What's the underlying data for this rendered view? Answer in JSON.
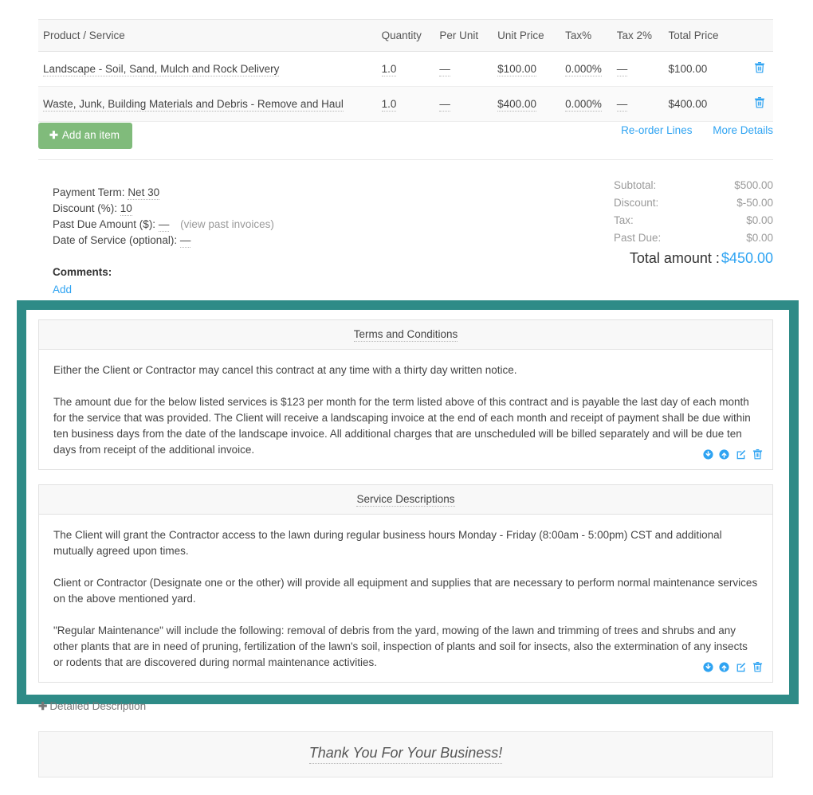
{
  "line_items_table": {
    "columns": [
      "Product / Service",
      "Quantity",
      "Per Unit",
      "Unit Price",
      "Tax%",
      "Tax 2%",
      "Total Price"
    ],
    "rows": [
      {
        "name": "Landscape - Soil, Sand, Mulch and Rock Delivery",
        "quantity": "1.0",
        "per_unit": "—",
        "unit_price": "$100.00",
        "tax_pct": "0.000%",
        "tax2_pct": "—",
        "total_price": "$100.00",
        "delete_icon": "trash-icon"
      },
      {
        "name": "Waste, Junk, Building Materials and Debris - Remove and Haul",
        "quantity": "1.0",
        "per_unit": "—",
        "unit_price": "$400.00",
        "tax_pct": "0.000%",
        "tax2_pct": "—",
        "total_price": "$400.00",
        "delete_icon": "trash-icon"
      }
    ]
  },
  "toolbar": {
    "add_item_label": "Add an item",
    "add_item_icon": "plus-icon",
    "reorder_lines_label": "Re-order Lines",
    "more_details_label": "More Details"
  },
  "payment_terms": {
    "payment_term_label": "Payment Term:",
    "payment_term_value": "Net 30",
    "discount_label": "Discount (%):",
    "discount_value": "10",
    "past_due_label": "Past Due Amount ($):",
    "past_due_value": "—",
    "view_past_invoices_label": "(view past invoices)",
    "date_of_service_label": "Date of Service (optional):",
    "date_of_service_value": "—",
    "comments_label": "Comments:",
    "comments_add_label": "Add"
  },
  "totals": {
    "subtotal_label": "Subtotal:",
    "subtotal_value": "$500.00",
    "discount_label": "Discount:",
    "discount_value": "$-50.00",
    "tax_label": "Tax:",
    "tax_value": "$0.00",
    "past_due_label": "Past Due:",
    "past_due_value": "$0.00",
    "total_label": "Total amount :",
    "total_value": "$450.00"
  },
  "highlight": {
    "color": "#2e8b87"
  },
  "panels": [
    {
      "id": "terms",
      "title": "Terms and Conditions",
      "paragraphs": [
        "Either the Client or Contractor may cancel this contract at any time with a thirty day written notice.",
        "The amount due for the below listed services is $123 per month for the term listed above of this contract and is payable the last day of each month for the service that was provided. The Client will receive a landscaping invoice at the end of each month and receipt of payment shall be due within ten business days from the date of the landscape invoice. All additional charges that are unscheduled will be billed separately and will be due ten days from receipt of the additional invoice."
      ]
    },
    {
      "id": "service",
      "title": "Service Descriptions",
      "paragraphs": [
        "The Client will grant the Contractor access to the lawn during regular business hours Monday - Friday (8:00am - 5:00pm) CST and additional mutually agreed upon times.",
        "Client or Contractor (Designate one or the other) will provide all equipment and supplies that are necessary to perform normal maintenance services on the above mentioned yard.",
        "\"Regular Maintenance\" will include the following: removal of debris from the yard, mowing of the lawn and trimming of trees and shrubs and any other plants that are in need of pruning, fertilization of the lawn's soil, inspection of plants and soil for insects, also the extermination of any insects or rodents that are discovered during normal maintenance activities."
      ]
    }
  ],
  "row_actions": {
    "move_down_icon": "arrow-down-circle-icon",
    "move_up_icon": "arrow-up-circle-icon",
    "edit_icon": "edit-square-icon",
    "delete_icon": "trash-icon",
    "color": "#2ea3f2"
  },
  "detailed_description": {
    "label": "Detailed Description",
    "icon": "plus-icon"
  },
  "footer": {
    "thank_you_text": "Thank You For Your Business!"
  }
}
